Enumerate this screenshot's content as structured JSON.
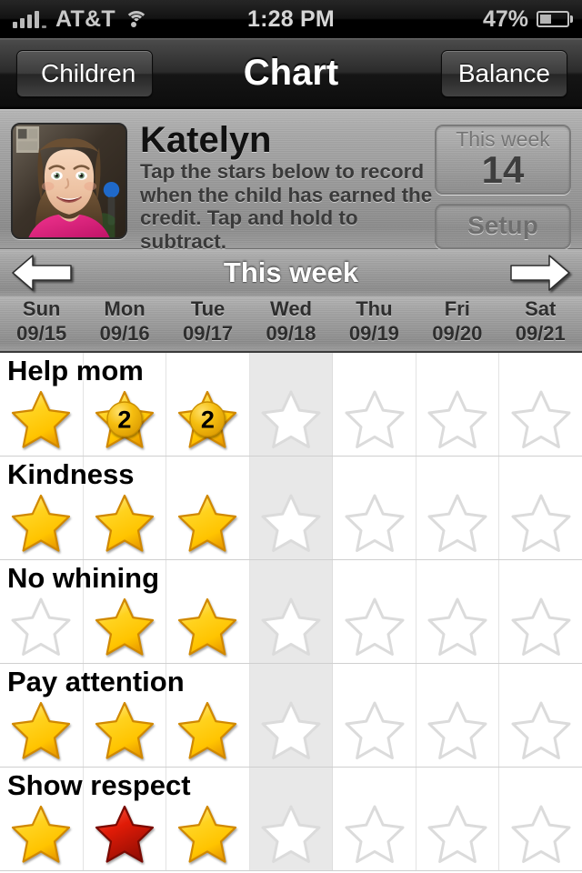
{
  "statusbar": {
    "carrier": "AT&T",
    "time": "1:28 PM",
    "battery_percent": "47%",
    "signal_icon": "signal-bars-icon",
    "wifi_icon": "wifi-icon",
    "battery_icon": "battery-icon",
    "battery_fill": 47
  },
  "navbar": {
    "back_label": "Children",
    "title": "Chart",
    "right_label": "Balance"
  },
  "profile": {
    "name": "Katelyn",
    "description": "Tap the stars below to record when the child has earned the credit. Tap and hold to subtract.",
    "avatar_icon": "child-photo-avatar",
    "week_box_label": "This week",
    "week_box_value": "14",
    "setup_label": "Setup"
  },
  "weeknav": {
    "prev_icon": "arrow-left-icon",
    "title": "This week",
    "next_icon": "arrow-right-icon"
  },
  "days": [
    {
      "name": "Sun",
      "date": "09/15",
      "today": false
    },
    {
      "name": "Mon",
      "date": "09/16",
      "today": false
    },
    {
      "name": "Tue",
      "date": "09/17",
      "today": false
    },
    {
      "name": "Wed",
      "date": "09/18",
      "today": true
    },
    {
      "name": "Thu",
      "date": "09/19",
      "today": false
    },
    {
      "name": "Fri",
      "date": "09/20",
      "today": false
    },
    {
      "name": "Sat",
      "date": "09/21",
      "today": false
    }
  ],
  "colors": {
    "star_gold": "#FFD21E",
    "star_gold_dark": "#E8A400",
    "star_red": "#D81A0B",
    "star_red_dark": "#8F0E04",
    "star_empty_outline": "#DBDBDB",
    "today_column": "#E8E8E8",
    "metal_base": "#9A9A9A",
    "navbar_dark": "#1A1A1A"
  },
  "chart_data": {
    "type": "table",
    "title": "Chart",
    "columns": [
      "Sun 09/15",
      "Mon 09/16",
      "Tue 09/17",
      "Wed 09/18",
      "Thu 09/19",
      "Fri 09/20",
      "Sat 09/21"
    ],
    "rows": [
      {
        "label": "Help mom",
        "cells": [
          {
            "state": "gold",
            "count": 1
          },
          {
            "state": "gold",
            "count": 2
          },
          {
            "state": "gold",
            "count": 2
          },
          {
            "state": "empty",
            "count": 0
          },
          {
            "state": "empty",
            "count": 0
          },
          {
            "state": "empty",
            "count": 0
          },
          {
            "state": "empty",
            "count": 0
          }
        ]
      },
      {
        "label": "Kindness",
        "cells": [
          {
            "state": "gold",
            "count": 1
          },
          {
            "state": "gold",
            "count": 1
          },
          {
            "state": "gold",
            "count": 1
          },
          {
            "state": "empty",
            "count": 0
          },
          {
            "state": "empty",
            "count": 0
          },
          {
            "state": "empty",
            "count": 0
          },
          {
            "state": "empty",
            "count": 0
          }
        ]
      },
      {
        "label": "No whining",
        "cells": [
          {
            "state": "empty",
            "count": 0
          },
          {
            "state": "gold",
            "count": 1
          },
          {
            "state": "gold",
            "count": 1
          },
          {
            "state": "empty",
            "count": 0
          },
          {
            "state": "empty",
            "count": 0
          },
          {
            "state": "empty",
            "count": 0
          },
          {
            "state": "empty",
            "count": 0
          }
        ]
      },
      {
        "label": "Pay attention",
        "cells": [
          {
            "state": "gold",
            "count": 1
          },
          {
            "state": "gold",
            "count": 1
          },
          {
            "state": "gold",
            "count": 1
          },
          {
            "state": "empty",
            "count": 0
          },
          {
            "state": "empty",
            "count": 0
          },
          {
            "state": "empty",
            "count": 0
          },
          {
            "state": "empty",
            "count": 0
          }
        ]
      },
      {
        "label": "Show respect",
        "cells": [
          {
            "state": "gold",
            "count": 1
          },
          {
            "state": "red",
            "count": 1
          },
          {
            "state": "gold",
            "count": 1
          },
          {
            "state": "empty",
            "count": 0
          },
          {
            "state": "empty",
            "count": 0
          },
          {
            "state": "empty",
            "count": 0
          },
          {
            "state": "empty",
            "count": 0
          }
        ]
      }
    ],
    "week_total": 14
  }
}
